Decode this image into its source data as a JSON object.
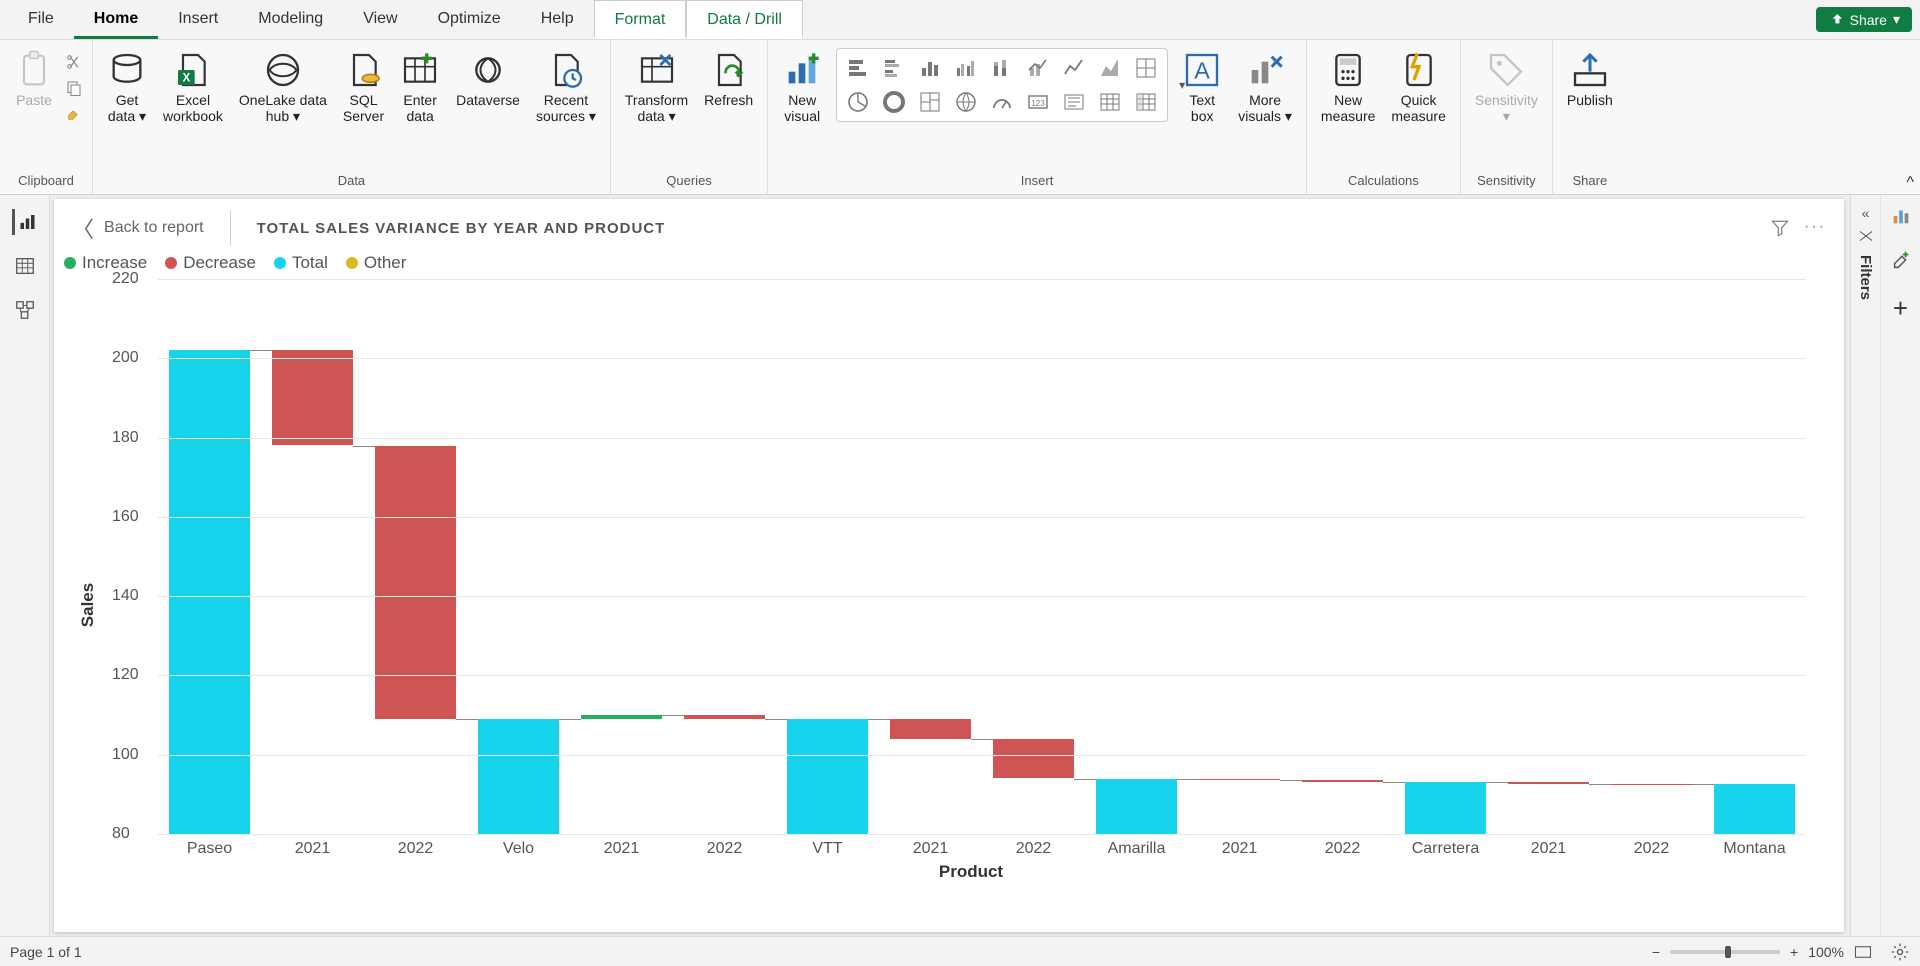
{
  "menu": {
    "tabs": [
      "File",
      "Home",
      "Insert",
      "Modeling",
      "View",
      "Optimize",
      "Help",
      "Format",
      "Data / Drill"
    ],
    "active": "Home",
    "context": [
      "Format",
      "Data / Drill"
    ],
    "share": "Share"
  },
  "ribbon": {
    "clipboard": {
      "paste": "Paste",
      "label": "Clipboard"
    },
    "data": {
      "get_data": "Get\ndata",
      "excel": "Excel\nworkbook",
      "onelake": "OneLake data\nhub",
      "sql": "SQL\nServer",
      "enter": "Enter\ndata",
      "dataverse": "Dataverse",
      "recent": "Recent\nsources",
      "label": "Data"
    },
    "queries": {
      "transform": "Transform\ndata",
      "refresh": "Refresh",
      "label": "Queries"
    },
    "insert": {
      "new_visual": "New\nvisual",
      "text_box": "Text\nbox",
      "more_visuals": "More\nvisuals",
      "label": "Insert"
    },
    "calculations": {
      "new_measure": "New\nmeasure",
      "quick_measure": "Quick\nmeasure",
      "label": "Calculations"
    },
    "sensitivity": {
      "sensitivity": "Sensitivity",
      "label": "Sensitivity"
    },
    "share": {
      "publish": "Publish",
      "label": "Share"
    }
  },
  "right_pane": {
    "filters": "Filters"
  },
  "visual": {
    "back": "Back to report",
    "title": "TOTAL SALES VARIANCE BY YEAR AND PRODUCT",
    "legend": {
      "increase": "Increase",
      "decrease": "Decrease",
      "total": "Total",
      "other": "Other"
    },
    "ylabel": "Sales",
    "xlabel": "Product"
  },
  "status": {
    "page": "Page 1 of 1",
    "zoom": "100%"
  },
  "colors": {
    "increase": "#27ae60",
    "decrease": "#cf5454",
    "total": "#17d3eb",
    "other": "#dbb925",
    "accent": "#107c41"
  },
  "chart_data": {
    "type": "waterfall",
    "ylabel": "Sales",
    "xlabel": "Product",
    "ylim": [
      80,
      220
    ],
    "yticks": [
      80,
      100,
      120,
      140,
      160,
      180,
      200,
      220
    ],
    "categories": [
      "Paseo",
      "2021",
      "2022",
      "Velo",
      "2021",
      "2022",
      "VTT",
      "2021",
      "2022",
      "Amarilla",
      "2021",
      "2022",
      "Carretera",
      "2021",
      "2022",
      "Montana"
    ],
    "bars": [
      {
        "cat": "Paseo",
        "type": "total",
        "start": 80,
        "end": 202
      },
      {
        "cat": "2021",
        "type": "decrease",
        "start": 202,
        "end": 178
      },
      {
        "cat": "2022",
        "type": "decrease",
        "start": 178,
        "end": 109
      },
      {
        "cat": "Velo",
        "type": "total",
        "start": 80,
        "end": 109
      },
      {
        "cat": "2021",
        "type": "increase",
        "start": 109,
        "end": 110
      },
      {
        "cat": "2022",
        "type": "decrease",
        "start": 110,
        "end": 109
      },
      {
        "cat": "VTT",
        "type": "total",
        "start": 80,
        "end": 109
      },
      {
        "cat": "2021",
        "type": "decrease",
        "start": 109,
        "end": 104
      },
      {
        "cat": "2022",
        "type": "decrease",
        "start": 104,
        "end": 94
      },
      {
        "cat": "Amarilla",
        "type": "total",
        "start": 80,
        "end": 94
      },
      {
        "cat": "2021",
        "type": "decrease",
        "start": 94,
        "end": 93.5
      },
      {
        "cat": "2022",
        "type": "decrease",
        "start": 93.5,
        "end": 93
      },
      {
        "cat": "Carretera",
        "type": "total",
        "start": 80,
        "end": 93
      },
      {
        "cat": "2021",
        "type": "decrease",
        "start": 93,
        "end": 92.7
      },
      {
        "cat": "2022",
        "type": "decrease",
        "start": 92.7,
        "end": 92.5
      },
      {
        "cat": "Montana",
        "type": "total",
        "start": 80,
        "end": 92.5
      }
    ]
  }
}
